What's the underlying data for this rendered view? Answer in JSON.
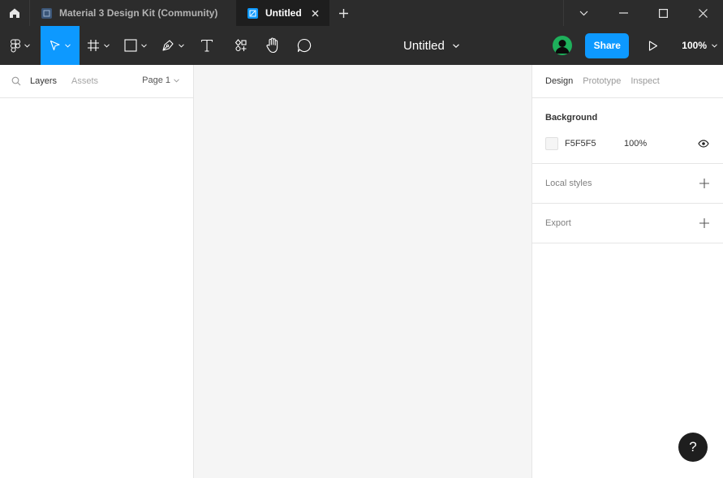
{
  "titlebar": {
    "home_icon": "home-icon",
    "tabs": [
      {
        "label": "Material 3 Design Kit (Community)",
        "icon": "figma-file-icon"
      },
      {
        "label": "Untitled",
        "icon": "figma-file-icon",
        "close_icon": "close-icon"
      }
    ],
    "new_tab_icon": "plus-icon",
    "window_controls": [
      "chevron-down-icon",
      "minimize-icon",
      "maximize-icon",
      "close-icon"
    ]
  },
  "toolbar": {
    "tools": [
      {
        "name": "main-menu",
        "icon": "figma-logo-icon"
      },
      {
        "name": "move",
        "icon": "cursor-arrow-icon",
        "active": true
      },
      {
        "name": "frame",
        "icon": "frame-icon"
      },
      {
        "name": "shape",
        "icon": "rectangle-icon"
      },
      {
        "name": "pen",
        "icon": "pen-icon"
      },
      {
        "name": "text",
        "icon": "text-icon"
      },
      {
        "name": "resources",
        "icon": "resources-icon"
      },
      {
        "name": "hand",
        "icon": "hand-icon"
      },
      {
        "name": "comment",
        "icon": "comment-icon"
      }
    ],
    "document_title": "Untitled",
    "share_label": "Share",
    "zoom": "100%"
  },
  "left_panel": {
    "tabs": [
      "Layers",
      "Assets"
    ],
    "page_selector": "Page 1"
  },
  "right_panel": {
    "tabs": [
      "Design",
      "Prototype",
      "Inspect"
    ],
    "background": {
      "title": "Background",
      "hex": "F5F5F5",
      "opacity": "100%"
    },
    "local_styles_label": "Local styles",
    "export_label": "Export"
  },
  "help_label": "?",
  "colors": {
    "chrome": "#2c2c2c",
    "active_tab": "#1e1e1e",
    "accent": "#0d99ff",
    "avatar": "#1eb05b",
    "canvas": "#f5f5f5"
  }
}
